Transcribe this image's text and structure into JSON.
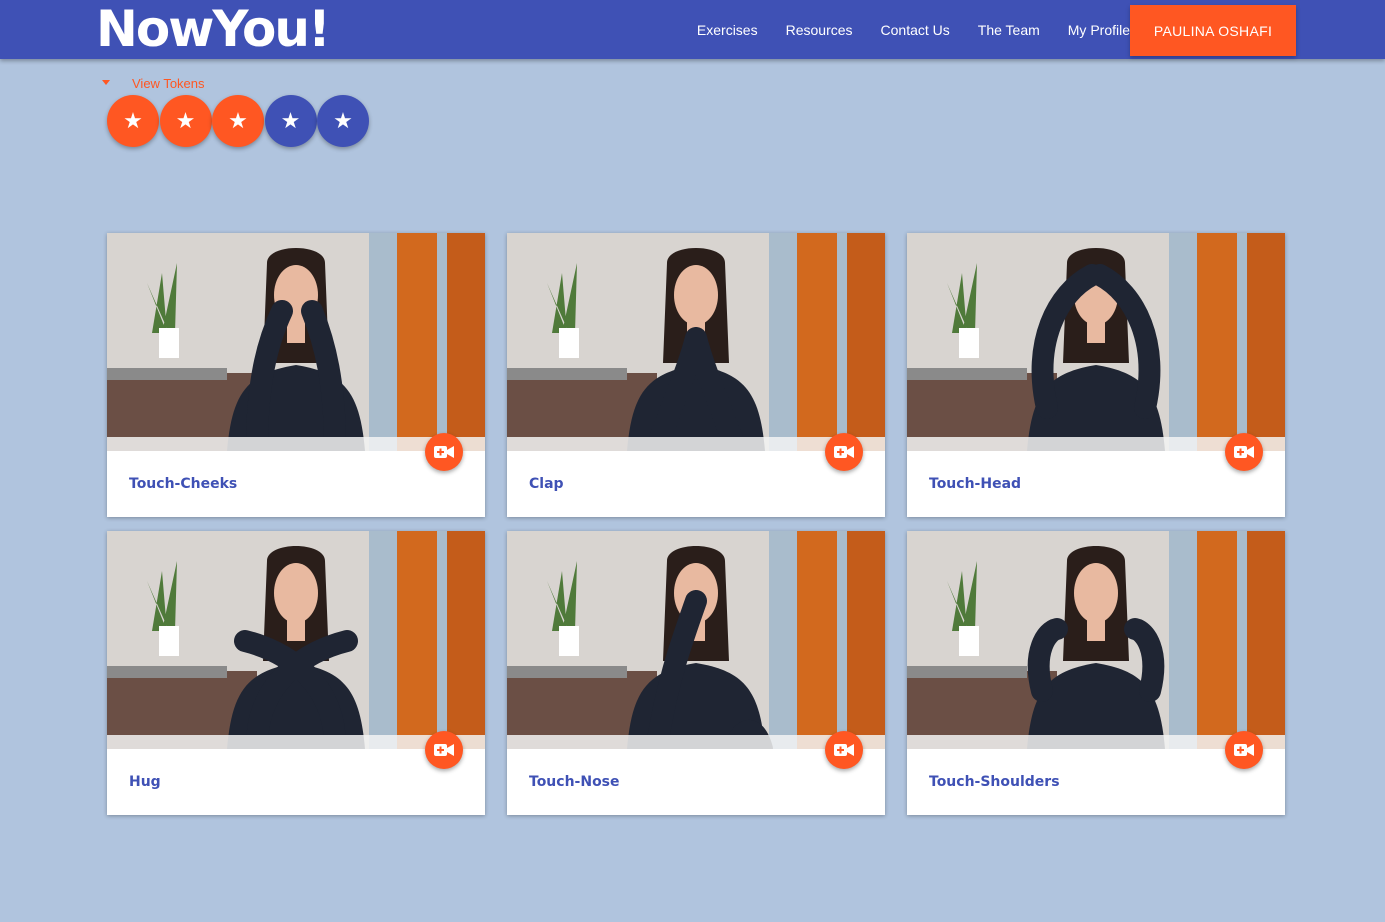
{
  "header": {
    "logo_text": "NowYou!",
    "nav": [
      "Exercises",
      "Resources",
      "Contact Us",
      "The Team",
      "My Profile"
    ],
    "profile_button": "PAULINA OSHAFI"
  },
  "tokens": {
    "toggle_label": "View Tokens",
    "earned": 3,
    "total": 5,
    "earned_color": "#ff5722",
    "locked_color": "#3f51b5",
    "icon": "star-icon"
  },
  "exercises": [
    {
      "title": "Touch-Cheeks",
      "pose": "touch-cheeks"
    },
    {
      "title": "Clap",
      "pose": "clap"
    },
    {
      "title": "Touch-Head",
      "pose": "touch-head"
    },
    {
      "title": "Hug",
      "pose": "hug"
    },
    {
      "title": "Touch-Nose",
      "pose": "touch-nose"
    },
    {
      "title": "Touch-Shoulders",
      "pose": "touch-shoulders"
    }
  ],
  "colors": {
    "primary": "#3f51b5",
    "accent": "#ff5722",
    "background": "#b0c4de"
  },
  "card_action_icon": "video-camera-add-icon"
}
